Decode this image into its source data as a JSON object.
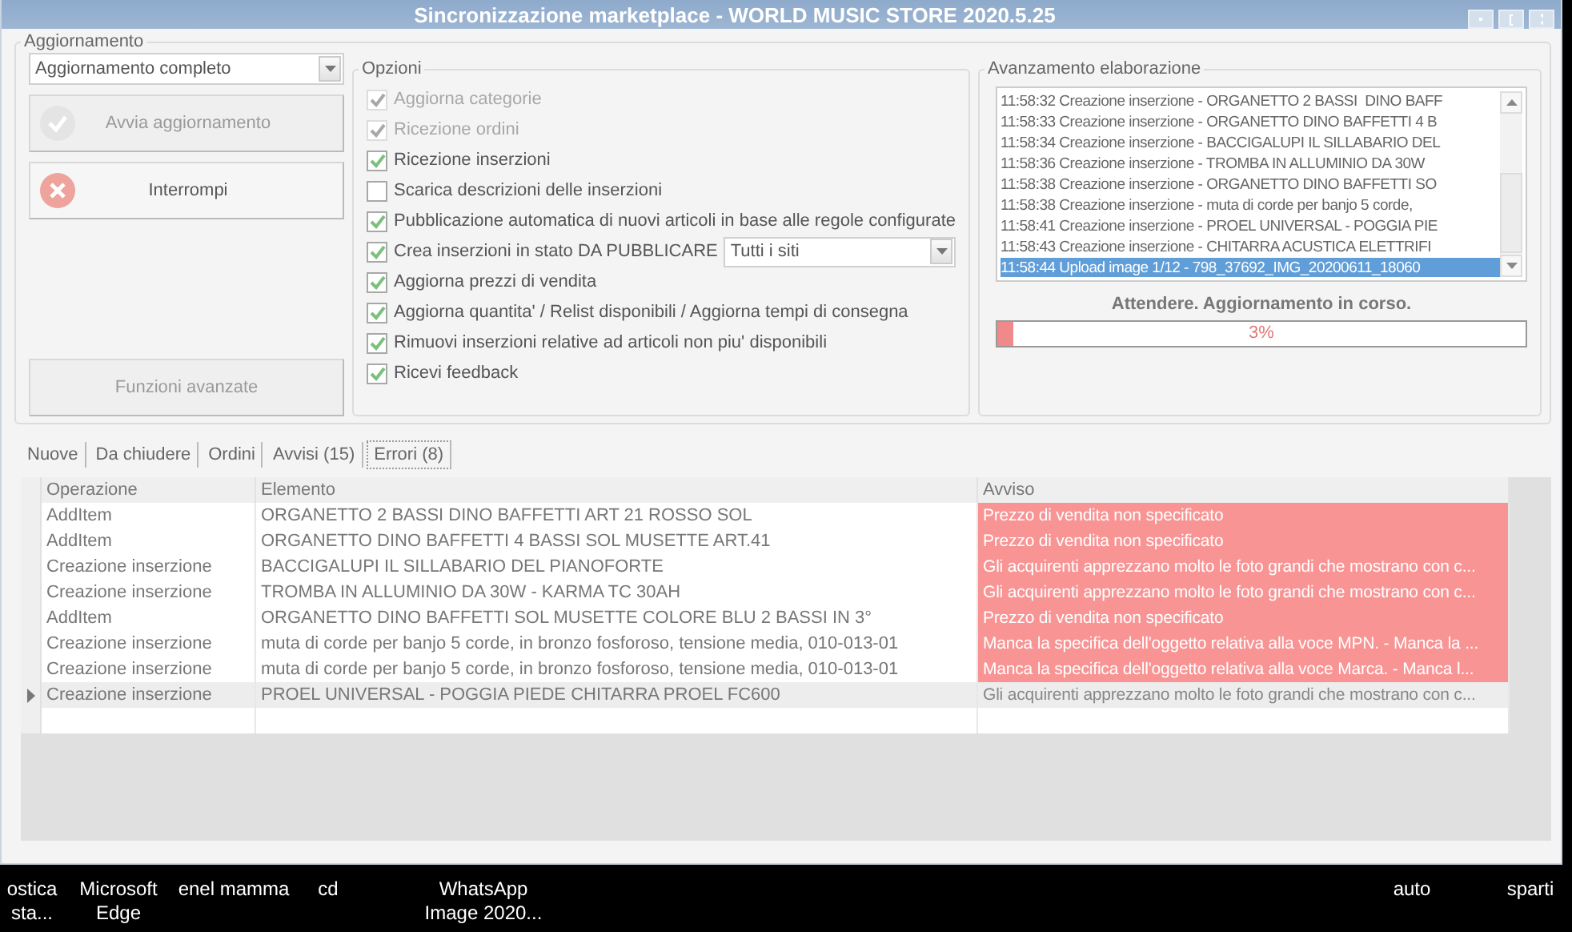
{
  "window": {
    "title": "Sincronizzazione marketplace - WORLD MUSIC STORE 2020.5.25"
  },
  "update_group": {
    "title": "Aggiornamento",
    "mode": "Aggiornamento completo",
    "buttons": [
      {
        "label": "Avvia aggiornamento",
        "kind": "start",
        "disabled": true
      },
      {
        "label": "Interrompi",
        "kind": "stop",
        "disabled": false
      }
    ],
    "advanced": {
      "label": "Funzioni avanzate",
      "disabled": true
    }
  },
  "options": {
    "title": "Opzioni",
    "items": [
      {
        "label": "Aggiorna categorie",
        "checked": true,
        "disabled": true
      },
      {
        "label": "Ricezione ordini",
        "checked": true,
        "disabled": true
      },
      {
        "label": "Ricezione inserzioni",
        "checked": true,
        "disabled": false
      },
      {
        "label": "Scarica descrizioni delle inserzioni",
        "checked": false,
        "disabled": false
      },
      {
        "label": "Pubblicazione automatica di nuovi articoli in base alle regole configurate",
        "checked": true,
        "disabled": false
      },
      {
        "label": "Crea inserzioni in stato DA PUBBLICARE",
        "checked": true,
        "disabled": false,
        "select": "Tutti i siti"
      },
      {
        "label": "Aggiorna prezzi di vendita",
        "checked": true,
        "disabled": false
      },
      {
        "label": "Aggiorna quantita' / Relist disponibili / Aggiorna tempi di consegna",
        "checked": true,
        "disabled": false
      },
      {
        "label": "Rimuovi inserzioni relative ad articoli non piu' disponibili",
        "checked": true,
        "disabled": false
      },
      {
        "label": "Ricevi feedback",
        "checked": true,
        "disabled": false
      }
    ]
  },
  "progress": {
    "title": "Avanzamento elaborazione",
    "log": [
      {
        "time": "11:58:32",
        "text": "Creazione inserzione - ORGANETTO 2 BASSI  DINO BAFF",
        "selected": false
      },
      {
        "time": "11:58:33",
        "text": "Creazione inserzione - ORGANETTO DINO BAFFETTI 4 B",
        "selected": false
      },
      {
        "time": "11:58:34",
        "text": "Creazione inserzione - BACCIGALUPI IL SILLABARIO DEL",
        "selected": false
      },
      {
        "time": "11:58:36",
        "text": "Creazione inserzione - TROMBA IN ALLUMINIO DA 30W",
        "selected": false
      },
      {
        "time": "11:58:38",
        "text": "Creazione inserzione - ORGANETTO DINO BAFFETTI SO",
        "selected": false
      },
      {
        "time": "11:58:38",
        "text": "Creazione inserzione - muta di corde per banjo 5 corde,",
        "selected": false
      },
      {
        "time": "11:58:41",
        "text": "Creazione inserzione - PROEL UNIVERSAL - POGGIA PIE",
        "selected": false
      },
      {
        "time": "11:58:43",
        "text": "Creazione inserzione - CHITARRA ACUSTICA ELETTRIFI",
        "selected": false
      },
      {
        "time": "11:58:44",
        "text": "Upload image 1/12 - 798_37692_IMG_20200611_18060",
        "selected": true
      }
    ],
    "status": "Attendere. Aggiornamento in corso.",
    "level": 0.03,
    "reading": "3%"
  },
  "tabs": [
    {
      "label": "Nuove",
      "selected": false
    },
    {
      "label": "Da chiudere",
      "selected": false
    },
    {
      "label": "Ordini",
      "selected": false
    },
    {
      "label": "Avvisi (15)",
      "selected": false
    },
    {
      "label": "Errori (8)",
      "selected": true
    }
  ],
  "table": {
    "columns": [
      "Operazione",
      "Elemento",
      "Avviso"
    ],
    "rows": [
      {
        "cells": [
          "AddItem",
          "ORGANETTO 2 BASSI  DINO BAFFETTI ART 21 ROSSO SOL",
          "Prezzo di vendita non specificato"
        ],
        "highlighted": true,
        "current": false
      },
      {
        "cells": [
          "AddItem",
          "ORGANETTO DINO BAFFETTI 4 BASSI SOL MUSETTE ART.41",
          "Prezzo di vendita non specificato"
        ],
        "highlighted": true,
        "current": false
      },
      {
        "cells": [
          "Creazione inserzione",
          "BACCIGALUPI IL SILLABARIO DEL PIANOFORTE",
          "Gli acquirenti apprezzano molto le foto grandi che mostrano con c..."
        ],
        "highlighted": true,
        "current": false
      },
      {
        "cells": [
          "Creazione inserzione",
          "TROMBA IN ALLUMINIO DA 30W - KARMA TC 30AH",
          "Gli acquirenti apprezzano molto le foto grandi che mostrano con c..."
        ],
        "highlighted": true,
        "current": false
      },
      {
        "cells": [
          "AddItem",
          "ORGANETTO DINO BAFFETTI SOL MUSETTE COLORE BLU 2 BASSI IN 3°",
          "Prezzo di vendita non specificato"
        ],
        "highlighted": true,
        "current": false
      },
      {
        "cells": [
          "Creazione inserzione",
          "muta di corde per banjo 5 corde, in bronzo fosforoso, tensione media, 010-013-01",
          "Manca la specifica dell'oggetto relativa alla voce MPN. - Manca la ..."
        ],
        "highlighted": true,
        "current": false
      },
      {
        "cells": [
          "Creazione inserzione",
          "muta di corde per banjo 5 corde, in bronzo fosforoso, tensione media, 010-013-01",
          "Manca la specifica dell'oggetto relativa alla voce Marca. - Manca l..."
        ],
        "highlighted": true,
        "current": false
      },
      {
        "cells": [
          "Creazione inserzione",
          "PROEL UNIVERSAL - POGGIA PIEDE CHITARRA PROEL FC600",
          "Gli acquirenti apprezzano molto le foto grandi che mostrano con c..."
        ],
        "highlighted": false,
        "current": true
      }
    ]
  },
  "desktop_icons": [
    {
      "label": "ostica sta..."
    },
    {
      "label": "Microsoft Edge"
    },
    {
      "label": "enel mamma"
    },
    {
      "label": "cd"
    },
    {
      "label": "WhatsApp Image 2020..."
    },
    {
      "label": "auto"
    },
    {
      "label": "sparti"
    }
  ]
}
